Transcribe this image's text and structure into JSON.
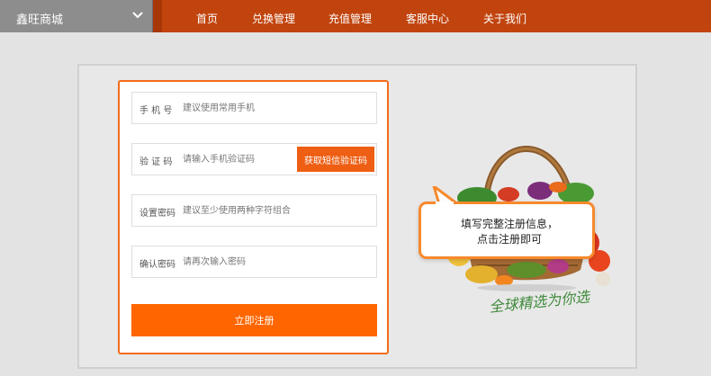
{
  "header": {
    "brand": "鑫旺商城",
    "nav": [
      "首页",
      "兑换管理",
      "充值管理",
      "客服中心",
      "关于我们"
    ]
  },
  "form": {
    "phone": {
      "label": "手 机 号",
      "placeholder": "建议使用常用手机"
    },
    "code": {
      "label": "验 证 码",
      "placeholder": "请输入手机验证码",
      "button": "获取短信验证码"
    },
    "password": {
      "label": "设置密码",
      "placeholder": "建议至少使用两种字符组合"
    },
    "confirm": {
      "label": "确认密码",
      "placeholder": "请再次输入密码"
    },
    "submit": "立即注册"
  },
  "tip": {
    "line1": "填写完整注册信息，",
    "line2": "点击注册即可"
  },
  "slogan": "全球精选为你选",
  "colors": {
    "nav_bg": "#c1440e",
    "accent": "#ff6600",
    "bubble_border": "#f7892c"
  },
  "icons": [
    "chevron-down-icon",
    "vegetable-basket-illustration"
  ]
}
